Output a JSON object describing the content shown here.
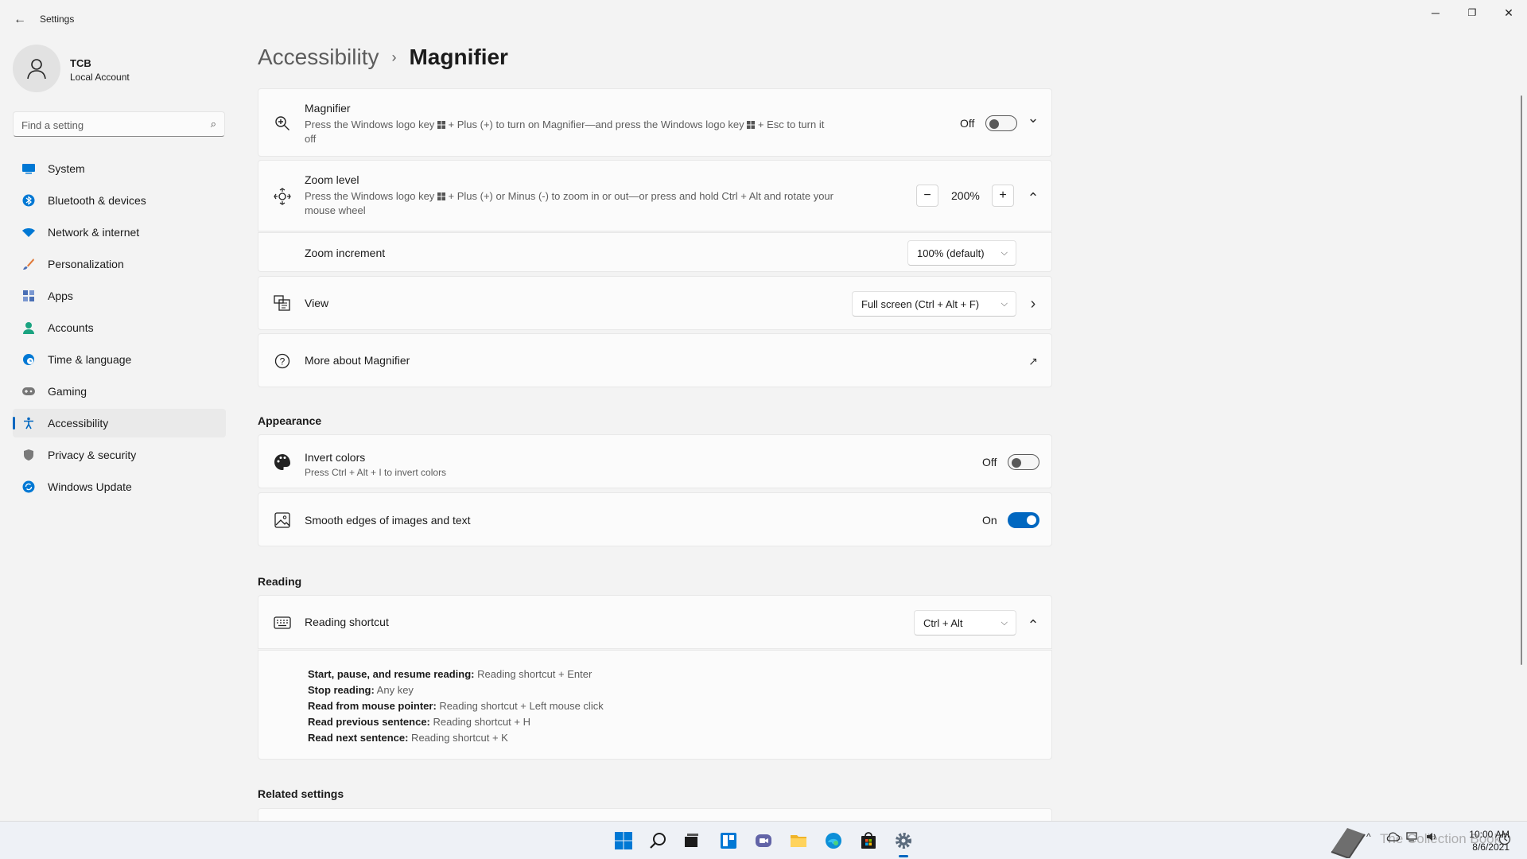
{
  "window": {
    "title": "Settings",
    "back_glyph": "←",
    "minimize_glyph": "─",
    "restore_glyph": "❐",
    "close_glyph": "✕"
  },
  "profile": {
    "name": "TCB",
    "account_type": "Local Account"
  },
  "search": {
    "placeholder": "Find a setting",
    "icon": "search-icon"
  },
  "nav": {
    "items": [
      {
        "label": "System",
        "icon": "system-icon",
        "color": "#0078d4"
      },
      {
        "label": "Bluetooth & devices",
        "icon": "bluetooth-icon",
        "color": "#0078d4"
      },
      {
        "label": "Network & internet",
        "icon": "wifi-icon",
        "color": "#0078d4"
      },
      {
        "label": "Personalization",
        "icon": "brush-icon",
        "color": "#e07a3b"
      },
      {
        "label": "Apps",
        "icon": "apps-icon",
        "color": "#4a6fb5"
      },
      {
        "label": "Accounts",
        "icon": "person-icon",
        "color": "#1aa380"
      },
      {
        "label": "Time & language",
        "icon": "globe-clock-icon",
        "color": "#0078d4"
      },
      {
        "label": "Gaming",
        "icon": "gamepad-icon",
        "color": "#777777"
      },
      {
        "label": "Accessibility",
        "icon": "accessibility-icon",
        "color": "#0067c0",
        "active": true
      },
      {
        "label": "Privacy & security",
        "icon": "shield-icon",
        "color": "#7a7a7a"
      },
      {
        "label": "Windows Update",
        "icon": "update-icon",
        "color": "#0078d4"
      }
    ]
  },
  "breadcrumb": {
    "parent": "Accessibility",
    "separator": "›",
    "current": "Magnifier"
  },
  "magnifier": {
    "title": "Magnifier",
    "desc_part1": "Press the Windows logo key ",
    "desc_part2": " + Plus (+) to turn on Magnifier—and press the Windows logo key ",
    "desc_part3": " + Esc to turn it",
    "desc_line2": "off",
    "state": "Off",
    "toggle_on": false,
    "expand_glyph": "⌄"
  },
  "zoom_level": {
    "title": "Zoom level",
    "desc_part1": "Press the Windows logo key ",
    "desc_part2": " + Plus (+) or Minus (-) to zoom in or out—or press and hold Ctrl + Alt and rotate your",
    "desc_line2": "mouse wheel",
    "minus": "−",
    "value": "200%",
    "plus": "+",
    "collapse_glyph": "⌃"
  },
  "zoom_increment": {
    "title": "Zoom increment",
    "value": "100% (default)"
  },
  "view": {
    "title": "View",
    "value": "Full screen (Ctrl + Alt + F)",
    "nav_glyph": "›"
  },
  "more_about": {
    "title": "More about Magnifier",
    "link_glyph": "↗"
  },
  "appearance": {
    "heading": "Appearance",
    "invert": {
      "title": "Invert colors",
      "desc": "Press Ctrl + Alt + I to invert colors",
      "state": "Off",
      "toggle_on": false
    },
    "smooth": {
      "title": "Smooth edges of images and text",
      "state": "On",
      "toggle_on": true
    }
  },
  "reading": {
    "heading": "Reading",
    "shortcut": {
      "title": "Reading shortcut",
      "value": "Ctrl + Alt",
      "collapse_glyph": "⌃"
    },
    "lines": [
      {
        "label": "Start, pause, and resume reading:",
        "value": " Reading shortcut + Enter"
      },
      {
        "label": "Stop reading:",
        "value": " Any key"
      },
      {
        "label": "Read from mouse pointer:",
        "value": " Reading shortcut + Left mouse click"
      },
      {
        "label": "Read previous sentence:",
        "value": " Reading shortcut + H"
      },
      {
        "label": "Read next sentence:",
        "value": " Reading shortcut + K"
      }
    ]
  },
  "related": {
    "heading": "Related settings"
  },
  "taskbar": {
    "apps": [
      "start-icon",
      "search-icon",
      "task-view-icon",
      "widgets-icon",
      "chat-icon",
      "file-explorer-icon",
      "edge-icon",
      "store-icon",
      "settings-icon"
    ],
    "time": "10:00 AM",
    "date": "8/6/2021",
    "watermark": "The Collection Book",
    "tray_chevron": "^"
  },
  "colors": {
    "accent": "#0067c0",
    "background": "#f3f3f3",
    "card": "#fbfbfb"
  }
}
